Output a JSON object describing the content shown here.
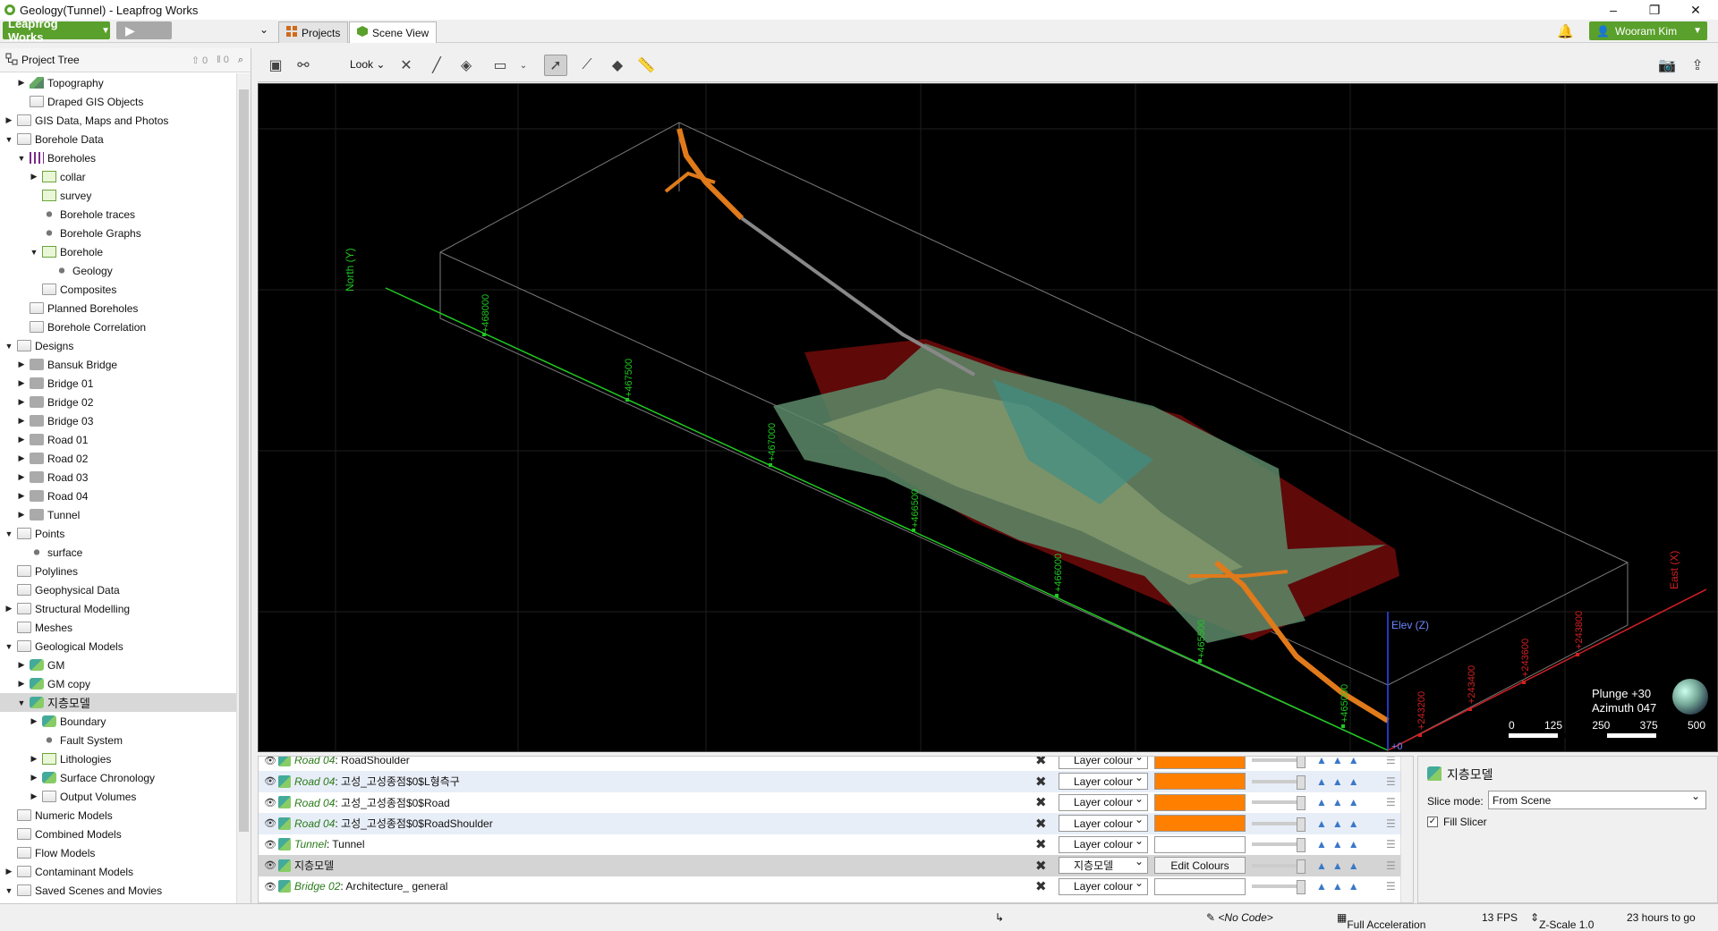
{
  "window": {
    "title": "Geology(Tunnel) - Leapfrog Works",
    "minimize": "–",
    "maximize": "❐",
    "close": "✕"
  },
  "menubar": {
    "app_button": "Leapfrog Works",
    "play_button": "▶",
    "tab_arrow": "⌄",
    "user": "Wooram Kim"
  },
  "tabs": [
    {
      "label": "Projects"
    },
    {
      "label": "Scene View"
    }
  ],
  "project_tree": {
    "title": "Project Tree",
    "counts": [
      "0",
      "0"
    ],
    "rows": [
      {
        "label": "Topography",
        "indent": 1,
        "exp": "▶",
        "icon": "topo"
      },
      {
        "label": "Draped GIS Objects",
        "indent": 1,
        "exp": "",
        "icon": "folder"
      },
      {
        "label": "GIS Data, Maps and Photos",
        "indent": 0,
        "exp": "▶",
        "icon": "folder"
      },
      {
        "label": "Borehole Data",
        "indent": 0,
        "exp": "▼",
        "icon": "folder"
      },
      {
        "label": "Boreholes",
        "indent": 1,
        "exp": "▼",
        "icon": "bh"
      },
      {
        "label": "collar",
        "indent": 2,
        "exp": "▶",
        "icon": "table"
      },
      {
        "label": "survey",
        "indent": 2,
        "exp": "",
        "icon": "table"
      },
      {
        "label": "Borehole traces",
        "indent": 2,
        "exp": "",
        "icon": "dot"
      },
      {
        "label": "Borehole Graphs",
        "indent": 2,
        "exp": "",
        "icon": "dot"
      },
      {
        "label": "Borehole",
        "indent": 2,
        "exp": "▼",
        "icon": "table"
      },
      {
        "label": "Geology",
        "indent": 3,
        "exp": "",
        "icon": "dot"
      },
      {
        "label": "Composites",
        "indent": 2,
        "exp": "",
        "icon": "folder"
      },
      {
        "label": "Planned Boreholes",
        "indent": 1,
        "exp": "",
        "icon": "folder"
      },
      {
        "label": "Borehole Correlation",
        "indent": 1,
        "exp": "",
        "icon": "folder"
      },
      {
        "label": "Designs",
        "indent": 0,
        "exp": "▼",
        "icon": "folder"
      },
      {
        "label": "Bansuk Bridge",
        "indent": 1,
        "exp": "▶",
        "icon": "gray"
      },
      {
        "label": "Bridge 01",
        "indent": 1,
        "exp": "▶",
        "icon": "gray"
      },
      {
        "label": "Bridge 02",
        "indent": 1,
        "exp": "▶",
        "icon": "gray"
      },
      {
        "label": "Bridge 03",
        "indent": 1,
        "exp": "▶",
        "icon": "gray"
      },
      {
        "label": "Road 01",
        "indent": 1,
        "exp": "▶",
        "icon": "gray"
      },
      {
        "label": "Road 02",
        "indent": 1,
        "exp": "▶",
        "icon": "gray"
      },
      {
        "label": "Road 03",
        "indent": 1,
        "exp": "▶",
        "icon": "gray"
      },
      {
        "label": "Road 04",
        "indent": 1,
        "exp": "▶",
        "icon": "gray"
      },
      {
        "label": "Tunnel",
        "indent": 1,
        "exp": "▶",
        "icon": "gray"
      },
      {
        "label": "Points",
        "indent": 0,
        "exp": "▼",
        "icon": "folder"
      },
      {
        "label": "surface",
        "indent": 1,
        "exp": "",
        "icon": "dot"
      },
      {
        "label": "Polylines",
        "indent": 0,
        "exp": "",
        "icon": "folder"
      },
      {
        "label": "Geophysical Data",
        "indent": 0,
        "exp": "",
        "icon": "folder"
      },
      {
        "label": "Structural Modelling",
        "indent": 0,
        "exp": "▶",
        "icon": "folder"
      },
      {
        "label": "Meshes",
        "indent": 0,
        "exp": "",
        "icon": "folder"
      },
      {
        "label": "Geological Models",
        "indent": 0,
        "exp": "▼",
        "icon": "folder"
      },
      {
        "label": "GM",
        "indent": 1,
        "exp": "▶",
        "icon": "gm"
      },
      {
        "label": "GM copy",
        "indent": 1,
        "exp": "▶",
        "icon": "gm"
      },
      {
        "label": "지층모델",
        "indent": 1,
        "exp": "▼",
        "icon": "gm",
        "selected": true
      },
      {
        "label": "Boundary",
        "indent": 2,
        "exp": "▶",
        "icon": "gm"
      },
      {
        "label": "Fault System",
        "indent": 2,
        "exp": "",
        "icon": "dot"
      },
      {
        "label": "Lithologies",
        "indent": 2,
        "exp": "▶",
        "icon": "table"
      },
      {
        "label": "Surface Chronology",
        "indent": 2,
        "exp": "▶",
        "icon": "gm"
      },
      {
        "label": "Output Volumes",
        "indent": 2,
        "exp": "▶",
        "icon": "folder"
      },
      {
        "label": "Numeric Models",
        "indent": 0,
        "exp": "",
        "icon": "folder"
      },
      {
        "label": "Combined Models",
        "indent": 0,
        "exp": "",
        "icon": "folder"
      },
      {
        "label": "Flow Models",
        "indent": 0,
        "exp": "",
        "icon": "folder"
      },
      {
        "label": "Contaminant Models",
        "indent": 0,
        "exp": "▶",
        "icon": "folder"
      },
      {
        "label": "Saved Scenes and Movies",
        "indent": 0,
        "exp": "▼",
        "icon": "folder"
      }
    ]
  },
  "scene_toolbar": {
    "look_label": "Look"
  },
  "scene": {
    "axis_north": "North (Y)",
    "axis_east": "East (X)",
    "axis_elev": "Elev (Z)",
    "origin_label": "+0",
    "north_ticks": [
      "+468000",
      "+467500",
      "+467000",
      "+466500",
      "+466000",
      "+465500",
      "+465000"
    ],
    "east_ticks": [
      "+243200",
      "+243400",
      "+243600",
      "+243800"
    ],
    "plunge": "Plunge +30",
    "azimuth": "Azimuth 047",
    "scale_labels": [
      "0",
      "125",
      "250",
      "375",
      "500"
    ]
  },
  "shape_list": {
    "rows": [
      {
        "prefix": "Road 04",
        "name": "RoadShoulder",
        "color_mode": "Layer colour",
        "swatch": "#ff8000"
      },
      {
        "prefix": "Road 04",
        "name": "고성_고성종점$0$L형측구",
        "color_mode": "Layer colour",
        "swatch": "#ff8000"
      },
      {
        "prefix": "Road 04",
        "name": "고성_고성종점$0$Road",
        "color_mode": "Layer colour",
        "swatch": "#ff8000"
      },
      {
        "prefix": "Road 04",
        "name": "고성_고성종점$0$RoadShoulder",
        "color_mode": "Layer colour",
        "swatch": "#ff8000"
      },
      {
        "prefix": "Tunnel",
        "name": "Tunnel",
        "color_mode": "Layer colour",
        "swatch": "#ffffff"
      },
      {
        "prefix": "",
        "name": "지층모델",
        "color_mode": "지층모델",
        "edit_label": "Edit Colours",
        "selected": true
      },
      {
        "prefix": "Bridge 02",
        "name": "Architecture_ general",
        "color_mode": "Layer colour",
        "swatch": "#ffffff"
      }
    ]
  },
  "properties": {
    "title": "지층모델",
    "slice_mode_label": "Slice mode:",
    "slice_mode_value": "From Scene",
    "fill_slicer_label": "Fill Slicer",
    "fill_slicer_checked": "✓"
  },
  "statusbar": {
    "code": "<No Code>",
    "acceleration": "Full Acceleration",
    "fps": "13 FPS",
    "zscale": "Z-Scale 1.0",
    "time_left": "23 hours to go"
  }
}
